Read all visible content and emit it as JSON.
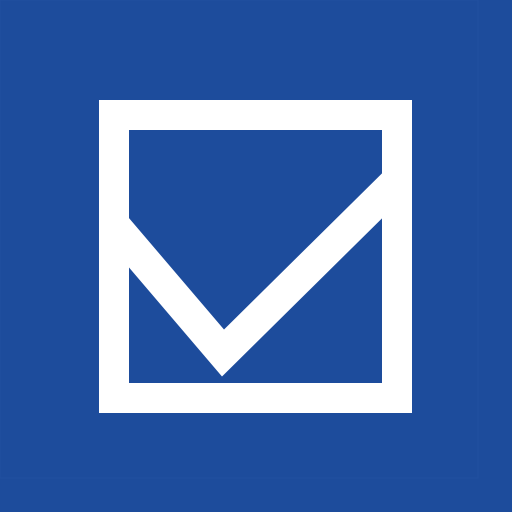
{
  "icon": {
    "name": "checkbox-check-icon",
    "background_color": "#1d4c9c",
    "stroke_color": "#ffffff",
    "state": "checked"
  }
}
